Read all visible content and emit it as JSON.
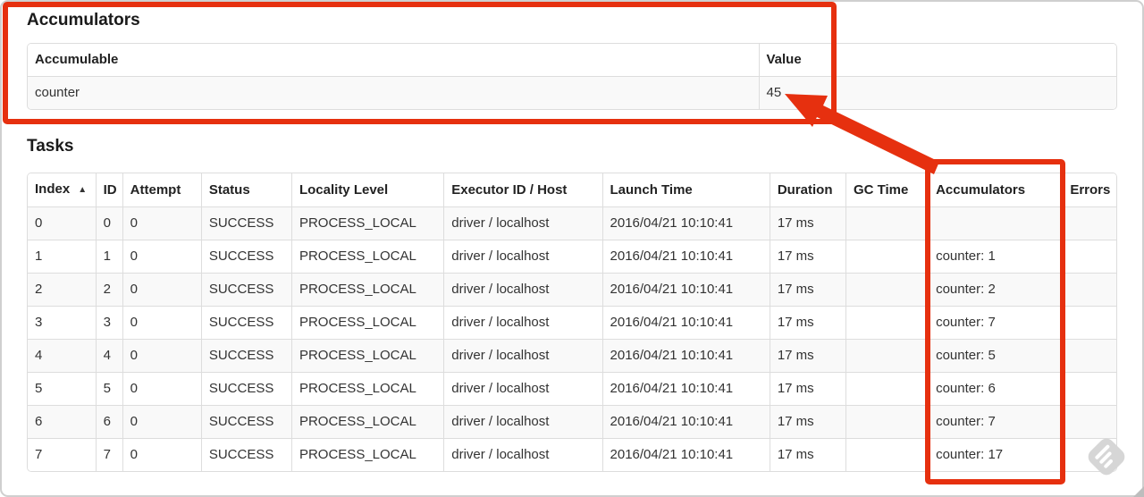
{
  "accumulators_section": {
    "title": "Accumulators",
    "table": {
      "headers": [
        "Accumulable",
        "Value"
      ],
      "rows": [
        [
          "counter",
          "45"
        ]
      ]
    }
  },
  "tasks_section": {
    "title": "Tasks",
    "sort_icon": "▲",
    "table": {
      "headers": [
        "Index",
        "ID",
        "Attempt",
        "Status",
        "Locality Level",
        "Executor ID / Host",
        "Launch Time",
        "Duration",
        "GC Time",
        "Accumulators",
        "Errors"
      ],
      "rows": [
        [
          "0",
          "0",
          "0",
          "SUCCESS",
          "PROCESS_LOCAL",
          "driver / localhost",
          "2016/04/21 10:10:41",
          "17 ms",
          "",
          "",
          ""
        ],
        [
          "1",
          "1",
          "0",
          "SUCCESS",
          "PROCESS_LOCAL",
          "driver / localhost",
          "2016/04/21 10:10:41",
          "17 ms",
          "",
          "counter: 1",
          ""
        ],
        [
          "2",
          "2",
          "0",
          "SUCCESS",
          "PROCESS_LOCAL",
          "driver / localhost",
          "2016/04/21 10:10:41",
          "17 ms",
          "",
          "counter: 2",
          ""
        ],
        [
          "3",
          "3",
          "0",
          "SUCCESS",
          "PROCESS_LOCAL",
          "driver / localhost",
          "2016/04/21 10:10:41",
          "17 ms",
          "",
          "counter: 7",
          ""
        ],
        [
          "4",
          "4",
          "0",
          "SUCCESS",
          "PROCESS_LOCAL",
          "driver / localhost",
          "2016/04/21 10:10:41",
          "17 ms",
          "",
          "counter: 5",
          ""
        ],
        [
          "5",
          "5",
          "0",
          "SUCCESS",
          "PROCESS_LOCAL",
          "driver / localhost",
          "2016/04/21 10:10:41",
          "17 ms",
          "",
          "counter: 6",
          ""
        ],
        [
          "6",
          "6",
          "0",
          "SUCCESS",
          "PROCESS_LOCAL",
          "driver / localhost",
          "2016/04/21 10:10:41",
          "17 ms",
          "",
          "counter: 7",
          ""
        ],
        [
          "7",
          "7",
          "0",
          "SUCCESS",
          "PROCESS_LOCAL",
          "driver / localhost",
          "2016/04/21 10:10:41",
          "17 ms",
          "",
          "counter: 17",
          ""
        ]
      ]
    }
  },
  "annotations": {
    "highlight_color": "#e6300f"
  }
}
